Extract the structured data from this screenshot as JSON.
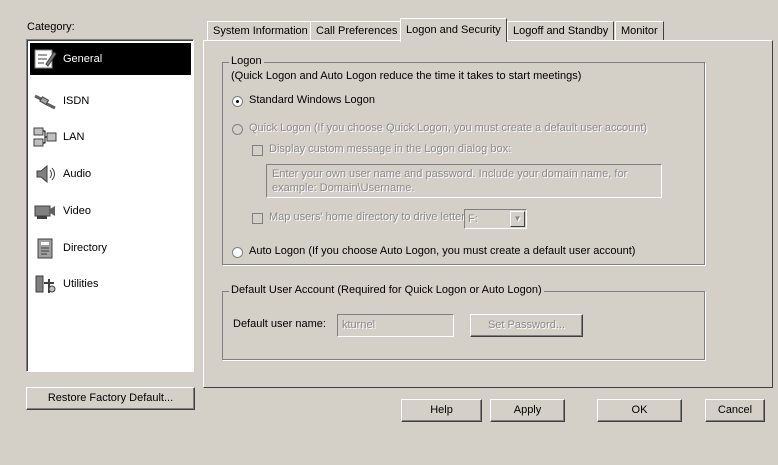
{
  "category_label": "Category:",
  "categories": [
    {
      "label": "General",
      "icon": "general-icon",
      "selected": true
    },
    {
      "label": "ISDN",
      "icon": "isdn-icon",
      "selected": false
    },
    {
      "label": "LAN",
      "icon": "lan-icon",
      "selected": false
    },
    {
      "label": "Audio",
      "icon": "audio-icon",
      "selected": false
    },
    {
      "label": "Video",
      "icon": "video-icon",
      "selected": false
    },
    {
      "label": "Directory",
      "icon": "directory-icon",
      "selected": false
    },
    {
      "label": "Utilities",
      "icon": "utilities-icon",
      "selected": false
    }
  ],
  "restore_button": "Restore Factory Default...",
  "tabs": [
    {
      "label": "System Information",
      "active": false
    },
    {
      "label": "Call Preferences",
      "active": false
    },
    {
      "label": "Logon and Security",
      "active": true
    },
    {
      "label": "Logoff and Standby",
      "active": false
    },
    {
      "label": "Monitor",
      "active": false
    }
  ],
  "logon": {
    "legend": "Logon",
    "description": "(Quick Logon and Auto Logon reduce the time it takes to start meetings)",
    "standard_label": "Standard Windows Logon",
    "quick_label": "Quick Logon (If you choose Quick Logon, you must create a default user account)",
    "display_custom_label": "Display custom message in the Logon dialog box:",
    "custom_message_line1": "Enter your own user name and password. Include your domain name, for",
    "custom_message_line2": "example: Domain\\Username.",
    "map_drive_label": "Map users' home directory to drive letter:",
    "drive_letter": "F:",
    "auto_label": "Auto Logon (If you choose Auto Logon, you must create a default user account)",
    "selected": "standard"
  },
  "default_account": {
    "legend": "Default User Account (Required for Quick Logon or Auto Logon)",
    "user_name_label": "Default user name:",
    "user_name_value": "kturnel",
    "set_password_button": "Set Password..."
  },
  "buttons": {
    "help": "Help",
    "apply": "Apply",
    "ok": "OK",
    "cancel": "Cancel"
  }
}
